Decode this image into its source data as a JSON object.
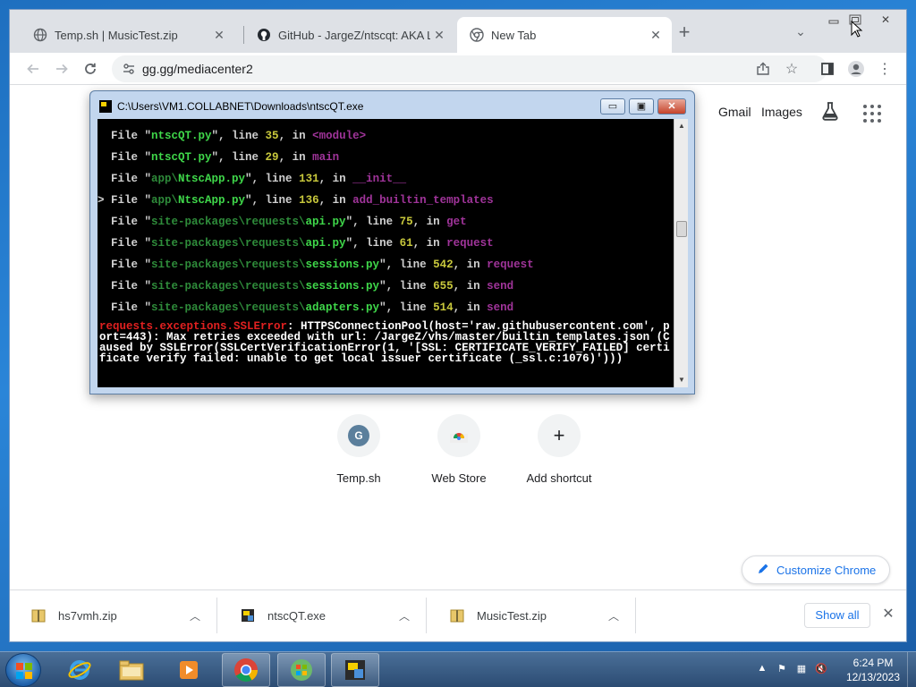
{
  "browser": {
    "tabs": [
      {
        "title": "Temp.sh | MusicTest.zip"
      },
      {
        "title": "GitHub - JargeZ/ntscqt: AKA LineDoubler"
      },
      {
        "title": "New Tab"
      }
    ],
    "url": "gg.gg/mediacenter2"
  },
  "ntp": {
    "gmail": "Gmail",
    "images": "Images",
    "shortcuts": [
      {
        "label": "Temp.sh",
        "glyph": "G"
      },
      {
        "label": "Web Store",
        "glyph": ""
      },
      {
        "label": "Add shortcut",
        "glyph": "+"
      }
    ],
    "customize": "Customize Chrome"
  },
  "downloads": {
    "items": [
      {
        "name": "hs7vmh.zip"
      },
      {
        "name": "ntscQT.exe"
      },
      {
        "name": "MusicTest.zip"
      }
    ],
    "show_all": "Show all"
  },
  "console": {
    "title": "C:\\Users\\VM1.COLLABNET\\Downloads\\ntscQT.exe",
    "lines": [
      {
        "prefix": "  ",
        "file": "ntscQT.py",
        "path": "",
        "line": "35",
        "fn": "<module>",
        "fncolor": "#a0349a"
      },
      {
        "prefix": "  ",
        "file": "ntscQT.py",
        "path": "",
        "line": "29",
        "fn": "main",
        "fncolor": "#a0349a"
      },
      {
        "prefix": "  ",
        "file": "NtscApp.py",
        "path": "app\\",
        "line": "131",
        "fn": "__init__",
        "fncolor": "#a0349a"
      },
      {
        "prefix": "> ",
        "file": "NtscApp.py",
        "path": "app\\",
        "line": "136",
        "fn": "add_builtin_templates",
        "fncolor": "#a0349a"
      },
      {
        "prefix": "  ",
        "file": "api.py",
        "path": "site-packages\\requests\\",
        "line": "75",
        "fn": "get",
        "fncolor": "#a0349a"
      },
      {
        "prefix": "  ",
        "file": "api.py",
        "path": "site-packages\\requests\\",
        "line": "61",
        "fn": "request",
        "fncolor": "#a0349a"
      },
      {
        "prefix": "  ",
        "file": "sessions.py",
        "path": "site-packages\\requests\\",
        "line": "542",
        "fn": "request",
        "fncolor": "#a0349a"
      },
      {
        "prefix": "  ",
        "file": "sessions.py",
        "path": "site-packages\\requests\\",
        "line": "655",
        "fn": "send",
        "fncolor": "#a0349a"
      },
      {
        "prefix": "  ",
        "file": "adapters.py",
        "path": "site-packages\\requests\\",
        "line": "514",
        "fn": "send",
        "fncolor": "#a0349a"
      }
    ],
    "error_type": "requests.exceptions.SSLError",
    "error_msg": ": HTTPSConnectionPool(host='raw.githubusercontent.com', port=443): Max retries exceeded with url: /JargeZ/vhs/master/builtin_templates.json (Caused by SSLError(SSLCertVerificationError(1, '[SSL: CERTIFICATE_VERIFY_FAILED] certificate verify failed: unable to get local issuer certificate (_ssl.c:1076)')))",
    "colors": {
      "file": "#3fd84a",
      "path": "#2e8b3a",
      "line": "#c8c83c",
      "text": "#d0d0d0",
      "error": "#e02020"
    }
  },
  "taskbar": {
    "time": "6:24 PM",
    "date": "12/13/2023"
  }
}
